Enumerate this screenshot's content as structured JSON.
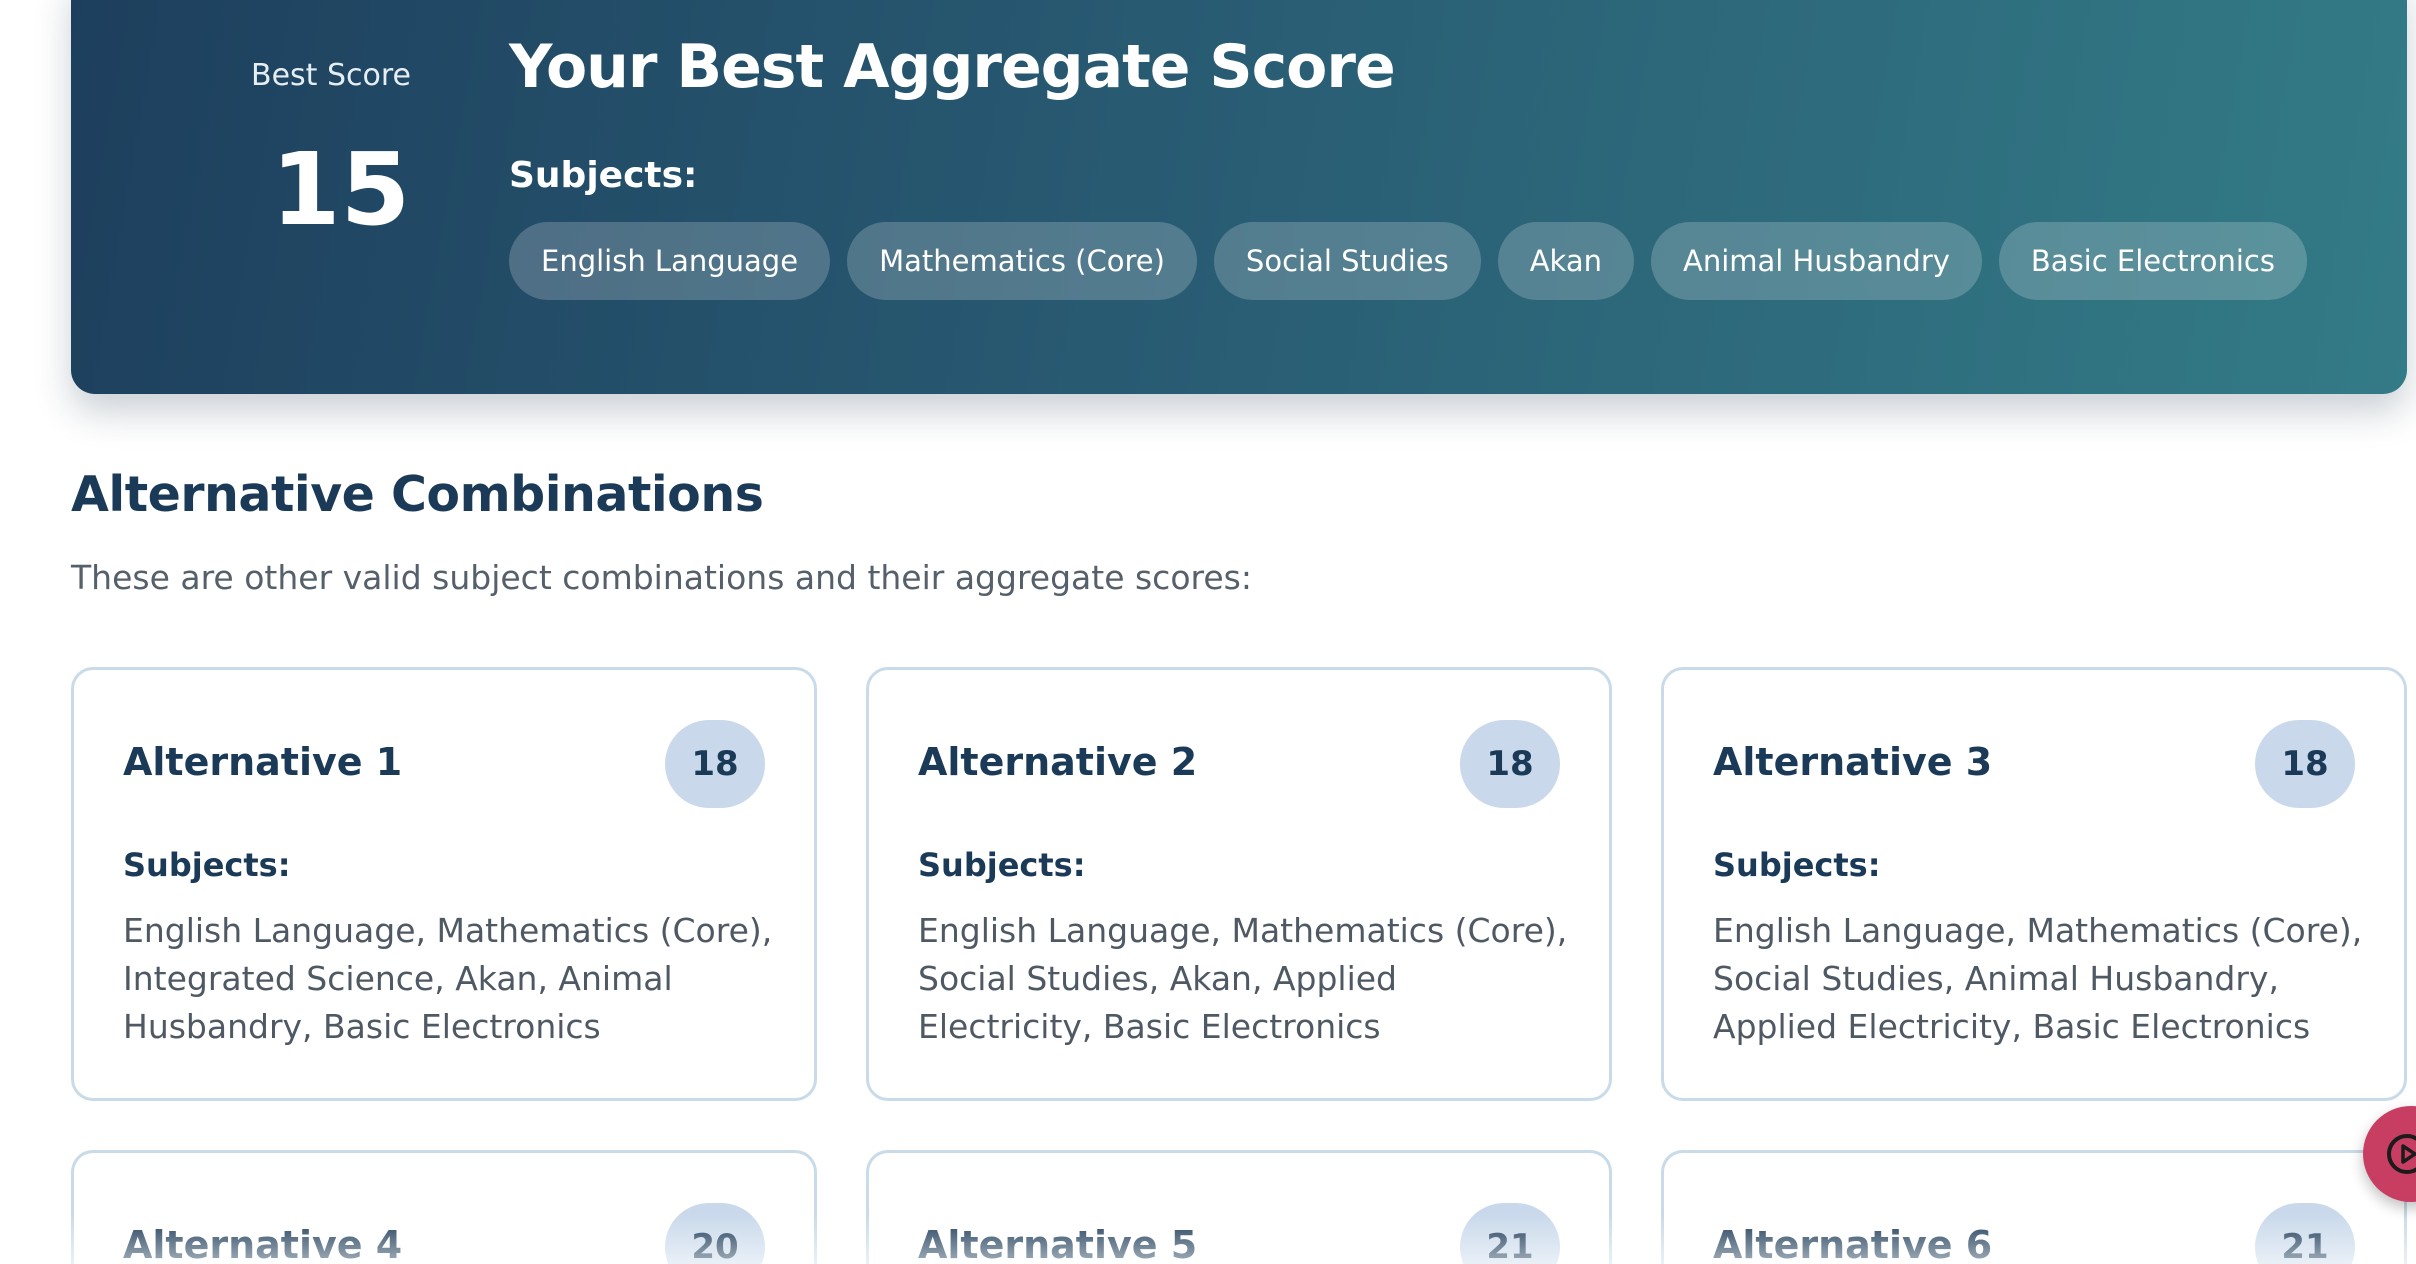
{
  "best": {
    "label": "Best Score",
    "value": "15",
    "title": "Your Best Aggregate Score",
    "subjects_label": "Subjects:",
    "subjects": [
      "English Language",
      "Mathematics (Core)",
      "Social Studies",
      "Akan",
      "Animal Husbandry",
      "Basic Electronics"
    ]
  },
  "alternatives": {
    "title": "Alternative Combinations",
    "description": "These are other valid subject combinations and their aggregate scores:",
    "subjects_label": "Subjects:",
    "cards": [
      {
        "title": "Alternative 1",
        "score": "18",
        "subjects": "English Language, Mathematics (Core), Integrated Science, Akan, Animal Husbandry, Basic Electronics"
      },
      {
        "title": "Alternative 2",
        "score": "18",
        "subjects": "English Language, Mathematics (Core), Social Studies, Akan, Applied Electricity, Basic Electronics"
      },
      {
        "title": "Alternative 3",
        "score": "18",
        "subjects": "English Language, Mathematics (Core), Social Studies, Animal Husbandry, Applied Electricity, Basic Electronics"
      },
      {
        "title": "Alternative 4",
        "score": "20"
      },
      {
        "title": "Alternative 5",
        "score": "21"
      },
      {
        "title": "Alternative 6",
        "score": "21"
      }
    ]
  },
  "fab": {
    "icon": "play-circle-icon",
    "color": "#c83e62"
  },
  "colors": {
    "banner_start": "#1d3f5d",
    "banner_end": "#337b86",
    "heading": "#1b3a57",
    "score_pill": "#c9d9eb",
    "card_border": "#c9dbe8"
  }
}
